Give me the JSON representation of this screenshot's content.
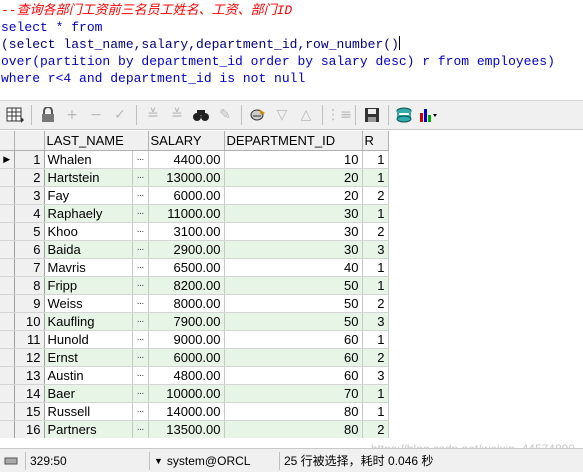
{
  "editor": {
    "line1": "--查询各部门工资前三名员工姓名、工资、部门ID",
    "line2": "select * from",
    "line3": "(select last_name,salary,department_id,row_number()",
    "line4": "over(partition by department_id order by salary desc) r from employees)",
    "line5": "where r<4 and department_id is not null"
  },
  "toolbar": {
    "icons": [
      "grid-icon",
      "lock-icon",
      "add-icon",
      "remove-icon",
      "post-icon",
      "filter-icon",
      "filter-clear-icon",
      "find-icon",
      "clear-icon",
      "query-icon",
      "up-icon",
      "down-icon",
      "chart-icon",
      "save-icon",
      "export-icon",
      "bar-chart-icon"
    ]
  },
  "grid": {
    "columns": [
      "LAST_NAME",
      "SALARY",
      "DEPARTMENT_ID",
      "R"
    ],
    "rows": [
      {
        "n": "1",
        "last_name": "Whalen",
        "salary": "4400.00",
        "dept": "10",
        "r": "1"
      },
      {
        "n": "2",
        "last_name": "Hartstein",
        "salary": "13000.00",
        "dept": "20",
        "r": "1"
      },
      {
        "n": "3",
        "last_name": "Fay",
        "salary": "6000.00",
        "dept": "20",
        "r": "2"
      },
      {
        "n": "4",
        "last_name": "Raphaely",
        "salary": "11000.00",
        "dept": "30",
        "r": "1"
      },
      {
        "n": "5",
        "last_name": "Khoo",
        "salary": "3100.00",
        "dept": "30",
        "r": "2"
      },
      {
        "n": "6",
        "last_name": "Baida",
        "salary": "2900.00",
        "dept": "30",
        "r": "3"
      },
      {
        "n": "7",
        "last_name": "Mavris",
        "salary": "6500.00",
        "dept": "40",
        "r": "1"
      },
      {
        "n": "8",
        "last_name": "Fripp",
        "salary": "8200.00",
        "dept": "50",
        "r": "1"
      },
      {
        "n": "9",
        "last_name": "Weiss",
        "salary": "8000.00",
        "dept": "50",
        "r": "2"
      },
      {
        "n": "10",
        "last_name": "Kaufling",
        "salary": "7900.00",
        "dept": "50",
        "r": "3"
      },
      {
        "n": "11",
        "last_name": "Hunold",
        "salary": "9000.00",
        "dept": "60",
        "r": "1"
      },
      {
        "n": "12",
        "last_name": "Ernst",
        "salary": "6000.00",
        "dept": "60",
        "r": "2"
      },
      {
        "n": "13",
        "last_name": "Austin",
        "salary": "4800.00",
        "dept": "60",
        "r": "3"
      },
      {
        "n": "14",
        "last_name": "Baer",
        "salary": "10000.00",
        "dept": "70",
        "r": "1"
      },
      {
        "n": "15",
        "last_name": "Russell",
        "salary": "14000.00",
        "dept": "80",
        "r": "1"
      },
      {
        "n": "16",
        "last_name": "Partners",
        "salary": "13500.00",
        "dept": "80",
        "r": "2"
      }
    ]
  },
  "status": {
    "position": "329:50",
    "connection": "system@ORCL",
    "message": "25 行被选择，耗时 0.046 秒"
  },
  "watermark": "https://blog.csdn.net/weixin_44574890"
}
